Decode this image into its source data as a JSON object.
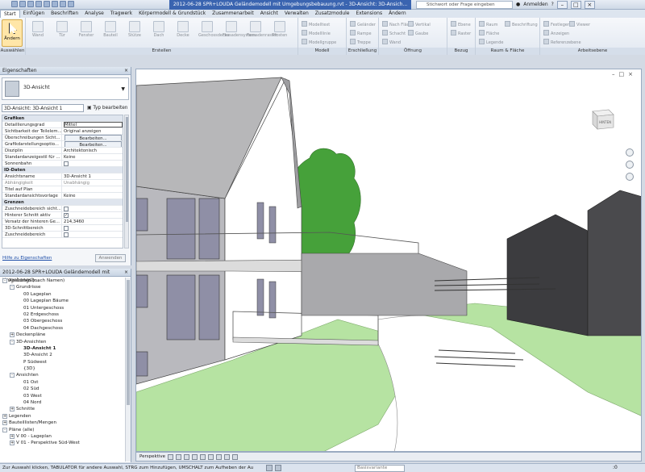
{
  "titlebar": {
    "title": "2012-06-28 SPR+LOUDA Geländemodell mit Umgebungsbebauung.rvt - 3D-Ansicht: 3D-Ansich...",
    "search_placeholder": "Stichwort oder Frage eingeben",
    "user": "Anmelden",
    "help": "?"
  },
  "menu": [
    "Start",
    "Einfügen",
    "Beschriften",
    "Analyse",
    "Tragwerk",
    "Körpermodell & Grundstück",
    "Zusammenarbeit",
    "Ansicht",
    "Verwalten",
    "Zusatzmodule",
    "Extensions",
    "Ändern"
  ],
  "ribbon": {
    "select": {
      "label": "Ändern",
      "group": "Auswählen"
    },
    "erstellen": {
      "group": "Erstellen",
      "items": [
        "Wand",
        "Tür",
        "Fenster",
        "Bauteil",
        "Stütze",
        "Dach",
        "Decke",
        "Geschossdecke",
        "Fassadensystem",
        "Fassadenraster",
        "Pfosten"
      ]
    },
    "modell": {
      "group": "Modell",
      "items": [
        "Modelltext",
        "Modelllinie",
        "Modellgruppe"
      ]
    },
    "erschliessung": {
      "group": "Erschließung",
      "items": [
        "Geländer",
        "Rampe",
        "Treppe"
      ]
    },
    "oeffnung": {
      "group": "Öffnung",
      "items": [
        "Nach Fläche",
        "Schacht",
        "Wand",
        "Vertikal",
        "Gaube"
      ]
    },
    "bezug": {
      "group": "Bezug",
      "items": [
        "Ebene",
        "Raster"
      ]
    },
    "raum": {
      "group": "Raum & Fläche",
      "items": [
        "Raum",
        "Fläche",
        "Legende",
        "Beschriftung"
      ]
    },
    "arbeitsebene": {
      "group": "Arbeitsebene",
      "items": [
        "Festlegen",
        "Anzeigen",
        "Referenzebene",
        "Viewer"
      ]
    }
  },
  "properties": {
    "title": "Eigenschaften",
    "type_name": "3D-Ansicht",
    "instance": "3D-Ansicht: 3D-Ansicht 1",
    "edit_type": "Typ bearbeiten",
    "rows": [
      {
        "sec": "Grafiken"
      },
      {
        "k": "Detaillierungsgrad",
        "v": "Mittel",
        "box": true
      },
      {
        "k": "Sichtbarkeit der Teilelem...",
        "v": "Original anzeigen"
      },
      {
        "k": "Überschreibungen Sicht...",
        "v": "Bearbeiten...",
        "btn": true
      },
      {
        "k": "Grafikdarstellungsoptio...",
        "v": "Bearbeiten...",
        "btn": true
      },
      {
        "k": "Disziplin",
        "v": "Architektonisch"
      },
      {
        "k": "Standardanzeigestil für ...",
        "v": "Keine"
      },
      {
        "k": "Sonnenbahn",
        "chk": ""
      },
      {
        "sec": "ID-Daten"
      },
      {
        "k": "Ansichtsname",
        "v": "3D-Ansicht 1"
      },
      {
        "k": "Abhängigkeit",
        "v": "Unabhängig",
        "grey": true
      },
      {
        "k": "Titel auf Plan",
        "v": ""
      },
      {
        "k": "Standardansichtsvorlage",
        "v": "Keine"
      },
      {
        "sec": "Grenzen"
      },
      {
        "k": "Zuschneidebereich sicht...",
        "chk": ""
      },
      {
        "k": "Hinterer Schnitt aktiv",
        "chk": "✓"
      },
      {
        "k": "Versatz der hinteren Ge...",
        "v": "214,3460"
      },
      {
        "k": "3D-Schnittbereich",
        "chk": ""
      },
      {
        "k": "Zuschneidebereich",
        "chk": ""
      }
    ],
    "help_link": "Hilfe zu Eigenschaften",
    "apply": "Anwenden"
  },
  "browser": {
    "title": "2012-06-28 SPR+LOUDA Geländemodell mit Umgebungsb...",
    "nodes": [
      {
        "t": "Ansichten (nach Namen)",
        "lvl": 0,
        "exp": "-"
      },
      {
        "t": "Grundrisse",
        "lvl": 1,
        "exp": "-"
      },
      {
        "t": "00 Lageplan",
        "lvl": 2
      },
      {
        "t": "00 Lageplan Bäume",
        "lvl": 2
      },
      {
        "t": "01 Untergeschoss",
        "lvl": 2
      },
      {
        "t": "02 Erdgeschoss",
        "lvl": 2
      },
      {
        "t": "03 Obergeschoss",
        "lvl": 2
      },
      {
        "t": "04 Dachgeschoss",
        "lvl": 2
      },
      {
        "t": "Deckenpläne",
        "lvl": 1,
        "exp": "+"
      },
      {
        "t": "3D-Ansichten",
        "lvl": 1,
        "exp": "-"
      },
      {
        "t": "3D-Ansicht 1",
        "lvl": 2,
        "bold": true
      },
      {
        "t": "3D-Ansicht 2",
        "lvl": 2
      },
      {
        "t": "P Südwest",
        "lvl": 2
      },
      {
        "t": "{3D}",
        "lvl": 2
      },
      {
        "t": "Ansichten",
        "lvl": 1,
        "exp": "-"
      },
      {
        "t": "01 Ost",
        "lvl": 2
      },
      {
        "t": "02 Süd",
        "lvl": 2
      },
      {
        "t": "03 West",
        "lvl": 2
      },
      {
        "t": "04 Nord",
        "lvl": 2
      },
      {
        "t": "Schnitte",
        "lvl": 1,
        "exp": "+"
      },
      {
        "t": "Legenden",
        "lvl": 0,
        "exp": "+"
      },
      {
        "t": "Bauteillisten/Mengen",
        "lvl": 0,
        "exp": "+"
      },
      {
        "t": "Pläne (alle)",
        "lvl": 0,
        "exp": "-"
      },
      {
        "t": "V 00 - Lageplan",
        "lvl": 1,
        "exp": "+"
      },
      {
        "t": "V 01 - Perspektive Süd-West",
        "lvl": 1,
        "exp": "+"
      }
    ]
  },
  "viewcube": {
    "face": "HINTEN"
  },
  "viewbar": {
    "label": "Perspektive"
  },
  "status": {
    "message": "Zur Auswahl klicken, TABULATOR für andere Auswahl, STRG zum Hinzufügen, UMSCHALT zum Aufheben der Au",
    "selector": "Basisvariante",
    "count": ":0"
  }
}
